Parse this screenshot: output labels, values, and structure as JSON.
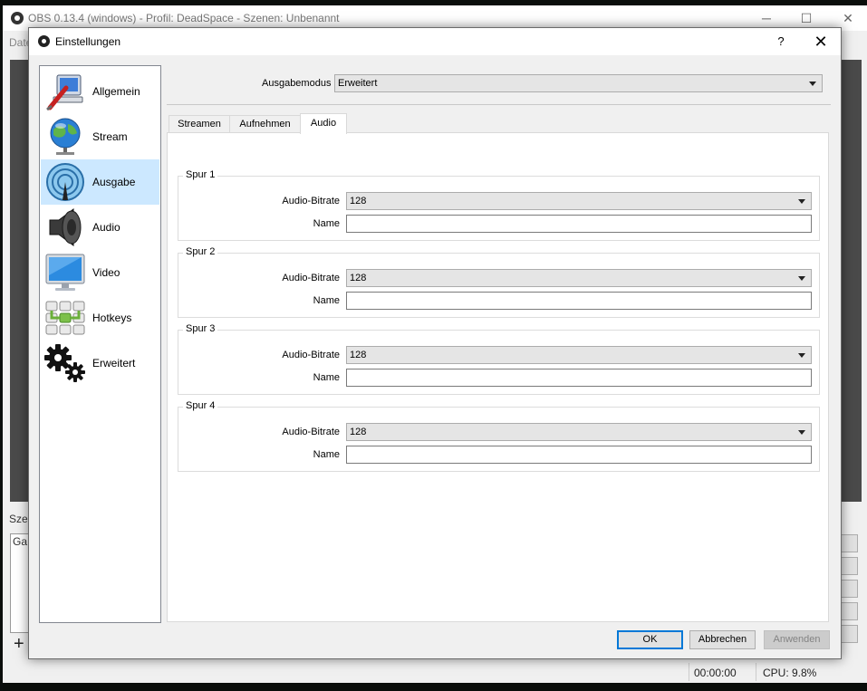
{
  "main_window": {
    "title": "OBS 0.13.4 (windows) - Profil: DeadSpace - Szenen: Unbenannt",
    "menu_first": "Date",
    "scenes_label": "Szen",
    "scene_item": "Ga",
    "add_symbol": "+",
    "status_time": "00:00:00",
    "status_cpu": "CPU: 9.8%",
    "controls": {
      "minimize": "─",
      "maximize": "☐",
      "close": "✕"
    }
  },
  "dialog": {
    "title": "Einstellungen",
    "help": "?",
    "close": "✕"
  },
  "sidebar": {
    "items": [
      {
        "label": "Allgemein",
        "icon": "general-icon",
        "active": false
      },
      {
        "label": "Stream",
        "icon": "stream-globe-icon",
        "active": false
      },
      {
        "label": "Ausgabe",
        "icon": "output-broadcast-icon",
        "active": true
      },
      {
        "label": "Audio",
        "icon": "speaker-icon",
        "active": false
      },
      {
        "label": "Video",
        "icon": "monitor-icon",
        "active": false
      },
      {
        "label": "Hotkeys",
        "icon": "keyboard-icon",
        "active": false
      },
      {
        "label": "Erweitert",
        "icon": "gears-icon",
        "active": false
      }
    ]
  },
  "output": {
    "mode_label": "Ausgabemodus",
    "mode_value": "Erweitert",
    "tabs": [
      {
        "label": "Streamen",
        "active": false
      },
      {
        "label": "Aufnehmen",
        "active": false
      },
      {
        "label": "Audio",
        "active": true
      }
    ],
    "tracks": [
      {
        "title": "Spur 1",
        "bitrate_label": "Audio-Bitrate",
        "bitrate": "128",
        "name_label": "Name",
        "name": ""
      },
      {
        "title": "Spur 2",
        "bitrate_label": "Audio-Bitrate",
        "bitrate": "128",
        "name_label": "Name",
        "name": ""
      },
      {
        "title": "Spur 3",
        "bitrate_label": "Audio-Bitrate",
        "bitrate": "128",
        "name_label": "Name",
        "name": ""
      },
      {
        "title": "Spur 4",
        "bitrate_label": "Audio-Bitrate",
        "bitrate": "128",
        "name_label": "Name",
        "name": ""
      }
    ]
  },
  "buttons": {
    "ok": "OK",
    "cancel": "Abbrechen",
    "apply": "Anwenden"
  },
  "colors": {
    "selection": "#cce8ff",
    "accent_border": "#0078d7"
  }
}
